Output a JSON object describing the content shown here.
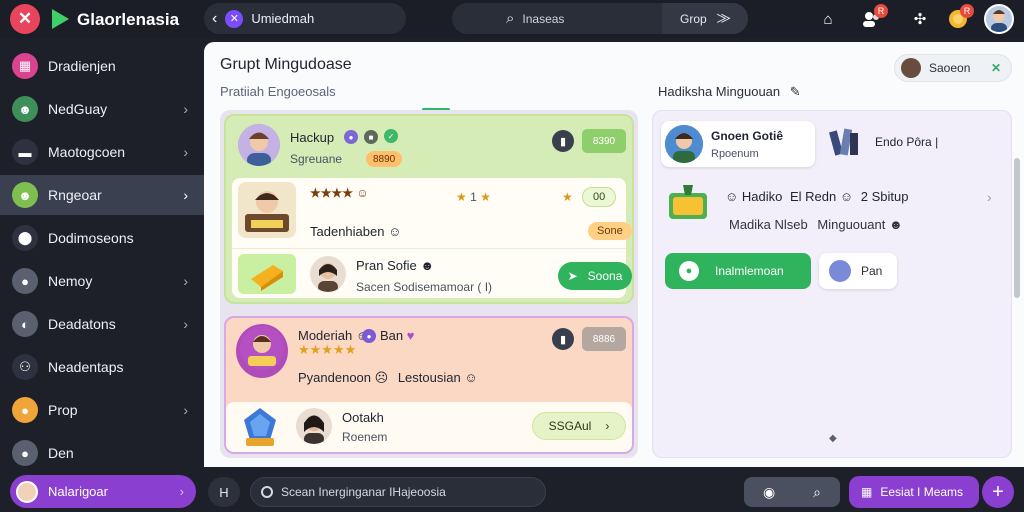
{
  "topbar": {
    "app_name": "Glaorlenasia",
    "chat_title": "Umiedmah",
    "search_placeholder": "Inaseas",
    "search_scope": "Grop",
    "notif_count_1": "R",
    "notif_count_2": "R"
  },
  "sidebar": {
    "items": [
      {
        "label": "Dradienjen",
        "icon": "grid-icon",
        "color": "#d9438f"
      },
      {
        "label": "NedGuay",
        "icon": "avatar-icon",
        "color": "#3f8f5a"
      },
      {
        "label": "Maotogcoen",
        "icon": "briefcase-icon",
        "color": "#2e3240"
      },
      {
        "label": "Rngeoar",
        "icon": "avatar-icon",
        "color": "#7fbf4f"
      },
      {
        "label": "Dodimoseons",
        "icon": "pin-icon",
        "color": "#2e3240"
      },
      {
        "label": "Nemoy",
        "icon": "circle-icon",
        "color": "#5b6070"
      },
      {
        "label": "Deadatons",
        "icon": "disc-icon",
        "color": "#5b6070"
      },
      {
        "label": "Neadentaps",
        "icon": "people-icon",
        "color": "#2e3240"
      },
      {
        "label": "Prop",
        "icon": "coin-icon",
        "color": "#f0a53a"
      },
      {
        "label": "Den",
        "icon": "dot-icon",
        "color": "#5b6070"
      }
    ]
  },
  "main": {
    "title": "Grupt Mingudoase",
    "subtitle": "Pratiiah Engoeosals",
    "right_header": "Hadiksha Minguouan",
    "session_label": "Saoeon",
    "card_a": {
      "row1_title": "Hackup",
      "row1_sub": "Sgreuane",
      "row1_badge": "8890",
      "row1_btn": "8390",
      "row2_title": "Tadenhiaben",
      "row2_stars": "1",
      "row2_count": "00",
      "row2_chip": "Sone",
      "row3_title": "Pran Sofie",
      "row3_sub": "Sacen Sodisemamoar ( I)",
      "row3_btn": "Soona"
    },
    "card_b": {
      "row1_title": "Moderiah",
      "row1_tag": "Ban",
      "row1_btn": "8886",
      "row2_title": "Pyandenoon",
      "row2_tag": "Lestousian",
      "row3_title": "Ootakh",
      "row3_sub": "Roenem",
      "row3_btn": "SSGAul"
    },
    "right": {
      "group_name": "Gnoen Gotiê",
      "group_sub": "Rpoenum",
      "group_tag": "Endo Pôra",
      "item_title": "Hadiko",
      "item_title_2": "El Redn",
      "item_title_3": "2 Sbitup",
      "item_sub": "Madika Nlseb",
      "item_sub_2": "Minguouant",
      "primary_btn": "Inalmlemoan",
      "secondary_btn": "Pan"
    }
  },
  "bottombar": {
    "user_name": "Nalarigoar",
    "message_placeholder": "Scean Inerginganar IHajeoosia",
    "send_label": "Eesiat I Meams",
    "left_btn": "H"
  }
}
